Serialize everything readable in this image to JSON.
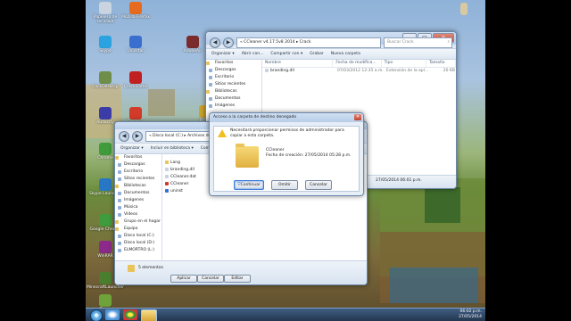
{
  "desktop": {
    "icons": [
      {
        "label": "Papelera de reciclaje",
        "color": "#c9d4e0"
      },
      {
        "label": "Mozilla Firefox",
        "color": "#e66b1e"
      },
      {
        "label": "Skype",
        "color": "#2aa3e0"
      },
      {
        "label": "Uninstall",
        "color": "#3a6fd0"
      },
      {
        "label": "AdobeAir",
        "color": "#7a2b2b"
      },
      {
        "label": "AIMP3",
        "color": "#3b4f9a"
      },
      {
        "label": "ClickDesktop",
        "color": "#6e8e4a"
      },
      {
        "label": "CrackGame",
        "color": "#c02020"
      },
      {
        "label": "Audacity",
        "color": "#3c3ca8"
      },
      {
        "label": "Ccleaner",
        "color": "#d23a2a"
      },
      {
        "label": "Chrome",
        "color": "#3f9b3b"
      },
      {
        "label": "Frapz",
        "color": "#cba42a"
      },
      {
        "label": "Skype Launcher",
        "color": "#2877c4"
      },
      {
        "label": "Google Chrome",
        "color": "#3f9b3b"
      },
      {
        "label": "WinRAR",
        "color": "#8b2a8b"
      },
      {
        "label": "MinecraftLauncher",
        "color": "#4b7d2f"
      },
      {
        "label": "uTorrent",
        "color": "#6fa33a"
      }
    ],
    "top_right_icon": {
      "label": "",
      "color": "#d8c9a3"
    }
  },
  "back_window": {
    "breadcrumb": "« CCleaner v4.17.5v8 2014 ▸ Crack",
    "search_placeholder": "Buscar Crack",
    "toolbar": [
      "Organizar ▾",
      "Abrir con...",
      "Compartir con ▾",
      "Grabar",
      "Nueva carpeta"
    ],
    "nav": [
      {
        "label": "Favoritos",
        "group": true
      },
      {
        "label": "Descargas"
      },
      {
        "label": "Escritorio"
      },
      {
        "label": "Sitios recientes"
      },
      {
        "label": "Bibliotecas",
        "group": true
      },
      {
        "label": "Documentos"
      },
      {
        "label": "Imágenes"
      }
    ],
    "columns": [
      "Nombre",
      "Fecha de modifica...",
      "Tipo",
      "Tamaño"
    ],
    "files": [
      {
        "name": "branding.dll",
        "date": "07/03/2012 12:35 a.m.",
        "type": "Extensión de la apl...",
        "size": "20 KB"
      }
    ],
    "status_date": "27/05/2014 06:01 p.m."
  },
  "front_window": {
    "breadcrumb": "« Disco local (C:) ▸ Archivos de pr...",
    "toolbar": [
      "Organizar ▾",
      "Incluir en biblioteca ▾",
      "Compartir"
    ],
    "nav": [
      {
        "label": "Favoritos",
        "group": true
      },
      {
        "label": "Descargas"
      },
      {
        "label": "Escritorio"
      },
      {
        "label": "Sitios recientes"
      },
      {
        "label": "Bibliotecas",
        "group": true
      },
      {
        "label": "Documentos"
      },
      {
        "label": "Imágenes"
      },
      {
        "label": "Música"
      },
      {
        "label": "Vídeos"
      },
      {
        "label": "Grupo en el hogar",
        "group": true
      },
      {
        "label": "Equipo",
        "group": true
      },
      {
        "label": "Disco local (C:)"
      },
      {
        "label": "Disco local (D:)"
      },
      {
        "label": "ELMORTRO (L:)"
      }
    ],
    "files": [
      {
        "name": "Lang",
        "color": "#e8c45a"
      },
      {
        "name": "branding.dll",
        "color": "#c8d2e0"
      },
      {
        "name": "CCleaner.dat",
        "color": "#c8d2e0"
      },
      {
        "name": "CCleaner",
        "color": "#d23a2a"
      },
      {
        "name": "uninst",
        "color": "#3a6fd0"
      }
    ],
    "item_count": "5 elementos",
    "buttons": [
      "Aplicar",
      "Cancelar",
      "Editar"
    ]
  },
  "dialog": {
    "title": "Acceso a la carpeta de destino denegado",
    "message": "Necesitará proporcionar permisos de administrador para copiar a esta carpeta.",
    "folder_name": "CCleaner",
    "folder_date": "Fecha de creación: 27/05/2014 05:28 p.m.",
    "buttons": {
      "continue": "Continuar",
      "skip": "Omitir",
      "cancel": "Cancelar"
    }
  },
  "taskbar": {
    "time": "06:02 p.m.",
    "date": "27/05/2014"
  }
}
